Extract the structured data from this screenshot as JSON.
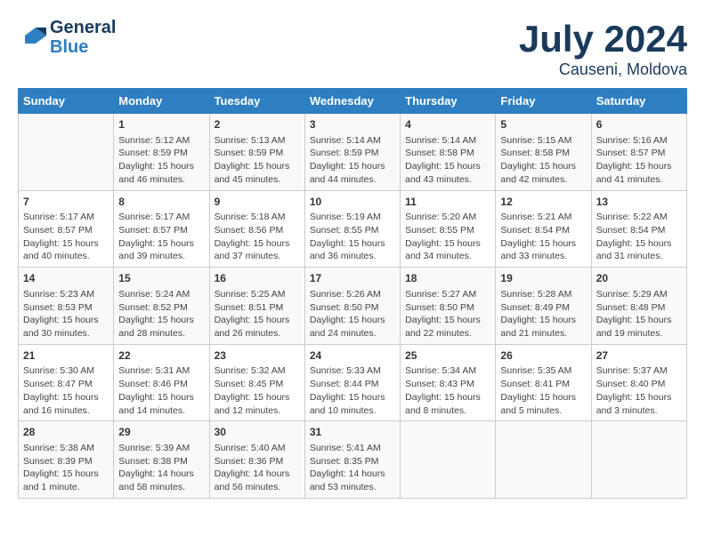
{
  "header": {
    "logo_line1": "General",
    "logo_line2": "Blue",
    "title": "July 2024",
    "subtitle": "Causeni, Moldova"
  },
  "days_of_week": [
    "Sunday",
    "Monday",
    "Tuesday",
    "Wednesday",
    "Thursday",
    "Friday",
    "Saturday"
  ],
  "weeks": [
    [
      {
        "day": "",
        "info": ""
      },
      {
        "day": "1",
        "info": "Sunrise: 5:12 AM\nSunset: 8:59 PM\nDaylight: 15 hours\nand 46 minutes."
      },
      {
        "day": "2",
        "info": "Sunrise: 5:13 AM\nSunset: 8:59 PM\nDaylight: 15 hours\nand 45 minutes."
      },
      {
        "day": "3",
        "info": "Sunrise: 5:14 AM\nSunset: 8:59 PM\nDaylight: 15 hours\nand 44 minutes."
      },
      {
        "day": "4",
        "info": "Sunrise: 5:14 AM\nSunset: 8:58 PM\nDaylight: 15 hours\nand 43 minutes."
      },
      {
        "day": "5",
        "info": "Sunrise: 5:15 AM\nSunset: 8:58 PM\nDaylight: 15 hours\nand 42 minutes."
      },
      {
        "day": "6",
        "info": "Sunrise: 5:16 AM\nSunset: 8:57 PM\nDaylight: 15 hours\nand 41 minutes."
      }
    ],
    [
      {
        "day": "7",
        "info": "Sunrise: 5:17 AM\nSunset: 8:57 PM\nDaylight: 15 hours\nand 40 minutes."
      },
      {
        "day": "8",
        "info": "Sunrise: 5:17 AM\nSunset: 8:57 PM\nDaylight: 15 hours\nand 39 minutes."
      },
      {
        "day": "9",
        "info": "Sunrise: 5:18 AM\nSunset: 8:56 PM\nDaylight: 15 hours\nand 37 minutes."
      },
      {
        "day": "10",
        "info": "Sunrise: 5:19 AM\nSunset: 8:55 PM\nDaylight: 15 hours\nand 36 minutes."
      },
      {
        "day": "11",
        "info": "Sunrise: 5:20 AM\nSunset: 8:55 PM\nDaylight: 15 hours\nand 34 minutes."
      },
      {
        "day": "12",
        "info": "Sunrise: 5:21 AM\nSunset: 8:54 PM\nDaylight: 15 hours\nand 33 minutes."
      },
      {
        "day": "13",
        "info": "Sunrise: 5:22 AM\nSunset: 8:54 PM\nDaylight: 15 hours\nand 31 minutes."
      }
    ],
    [
      {
        "day": "14",
        "info": "Sunrise: 5:23 AM\nSunset: 8:53 PM\nDaylight: 15 hours\nand 30 minutes."
      },
      {
        "day": "15",
        "info": "Sunrise: 5:24 AM\nSunset: 8:52 PM\nDaylight: 15 hours\nand 28 minutes."
      },
      {
        "day": "16",
        "info": "Sunrise: 5:25 AM\nSunset: 8:51 PM\nDaylight: 15 hours\nand 26 minutes."
      },
      {
        "day": "17",
        "info": "Sunrise: 5:26 AM\nSunset: 8:50 PM\nDaylight: 15 hours\nand 24 minutes."
      },
      {
        "day": "18",
        "info": "Sunrise: 5:27 AM\nSunset: 8:50 PM\nDaylight: 15 hours\nand 22 minutes."
      },
      {
        "day": "19",
        "info": "Sunrise: 5:28 AM\nSunset: 8:49 PM\nDaylight: 15 hours\nand 21 minutes."
      },
      {
        "day": "20",
        "info": "Sunrise: 5:29 AM\nSunset: 8:48 PM\nDaylight: 15 hours\nand 19 minutes."
      }
    ],
    [
      {
        "day": "21",
        "info": "Sunrise: 5:30 AM\nSunset: 8:47 PM\nDaylight: 15 hours\nand 16 minutes."
      },
      {
        "day": "22",
        "info": "Sunrise: 5:31 AM\nSunset: 8:46 PM\nDaylight: 15 hours\nand 14 minutes."
      },
      {
        "day": "23",
        "info": "Sunrise: 5:32 AM\nSunset: 8:45 PM\nDaylight: 15 hours\nand 12 minutes."
      },
      {
        "day": "24",
        "info": "Sunrise: 5:33 AM\nSunset: 8:44 PM\nDaylight: 15 hours\nand 10 minutes."
      },
      {
        "day": "25",
        "info": "Sunrise: 5:34 AM\nSunset: 8:43 PM\nDaylight: 15 hours\nand 8 minutes."
      },
      {
        "day": "26",
        "info": "Sunrise: 5:35 AM\nSunset: 8:41 PM\nDaylight: 15 hours\nand 5 minutes."
      },
      {
        "day": "27",
        "info": "Sunrise: 5:37 AM\nSunset: 8:40 PM\nDaylight: 15 hours\nand 3 minutes."
      }
    ],
    [
      {
        "day": "28",
        "info": "Sunrise: 5:38 AM\nSunset: 8:39 PM\nDaylight: 15 hours\nand 1 minute."
      },
      {
        "day": "29",
        "info": "Sunrise: 5:39 AM\nSunset: 8:38 PM\nDaylight: 14 hours\nand 58 minutes."
      },
      {
        "day": "30",
        "info": "Sunrise: 5:40 AM\nSunset: 8:36 PM\nDaylight: 14 hours\nand 56 minutes."
      },
      {
        "day": "31",
        "info": "Sunrise: 5:41 AM\nSunset: 8:35 PM\nDaylight: 14 hours\nand 53 minutes."
      },
      {
        "day": "",
        "info": ""
      },
      {
        "day": "",
        "info": ""
      },
      {
        "day": "",
        "info": ""
      }
    ]
  ]
}
